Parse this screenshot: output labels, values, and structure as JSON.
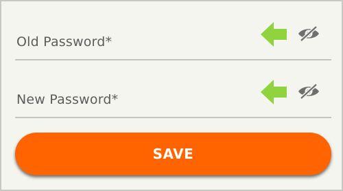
{
  "form": {
    "old_password": {
      "label": "Old Password*"
    },
    "new_password": {
      "label": "New Password*"
    },
    "save_label": "SAVE"
  },
  "icons": {
    "pointer_arrow": "left-arrow-icon",
    "visibility_toggle": "eye-slash-icon"
  },
  "colors": {
    "background": "#f5f5f0",
    "accent": "#ff6400",
    "arrow": "#8fd43e",
    "label": "#5c5c5c",
    "underline": "#c4c4c2"
  }
}
